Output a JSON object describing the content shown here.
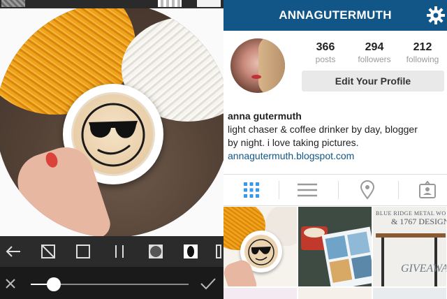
{
  "editor": {
    "toolbar": {
      "tools": [
        {
          "icon": "back-arrow-icon"
        },
        {
          "icon": "diagonal-crop-icon"
        },
        {
          "icon": "square-frame-icon"
        },
        {
          "icon": "parallel-lines-icon"
        },
        {
          "icon": "circle-vignette-icon"
        },
        {
          "icon": "oval-vignette-icon"
        }
      ]
    },
    "bottombar": {
      "cancel_icon": "close-icon",
      "confirm_icon": "checkmark-icon",
      "slider_value": 0.1
    },
    "photo": {
      "description_icons": [
        "yarn-orange",
        "yarn-white",
        "coffee-cup",
        "sunglasses-emoji"
      ]
    }
  },
  "profile": {
    "header": {
      "username": "ANNAGUTERMUTH",
      "settings_icon": "gear-icon"
    },
    "stats": [
      {
        "value": "366",
        "label": "posts"
      },
      {
        "value": "294",
        "label": "followers"
      },
      {
        "value": "212",
        "label": "following"
      }
    ],
    "edit_button": "Edit Your Profile",
    "bio": {
      "name": "anna gutermuth",
      "line1": "light chaser & coffee drinker by day, blogger",
      "line2": "by night. i love taking pictures.",
      "link": "annagutermuth.blogspot.com"
    },
    "tabs": [
      {
        "icon": "grid-view-icon",
        "active": true
      },
      {
        "icon": "list-view-icon",
        "active": false
      },
      {
        "icon": "location-pin-icon",
        "active": false
      },
      {
        "icon": "tagged-photos-icon",
        "active": false
      }
    ],
    "grid_posts": [
      {
        "caption": ""
      },
      {
        "caption": ""
      },
      {
        "caption_line1": "BLUE RIDGE METAL WOR",
        "caption_line2": "& 1767 DESIGN",
        "caption_line3": "GIVEAWA"
      }
    ],
    "colors": {
      "header_bg": "#125688",
      "active_tab": "#3897f0",
      "link": "#125688"
    }
  }
}
